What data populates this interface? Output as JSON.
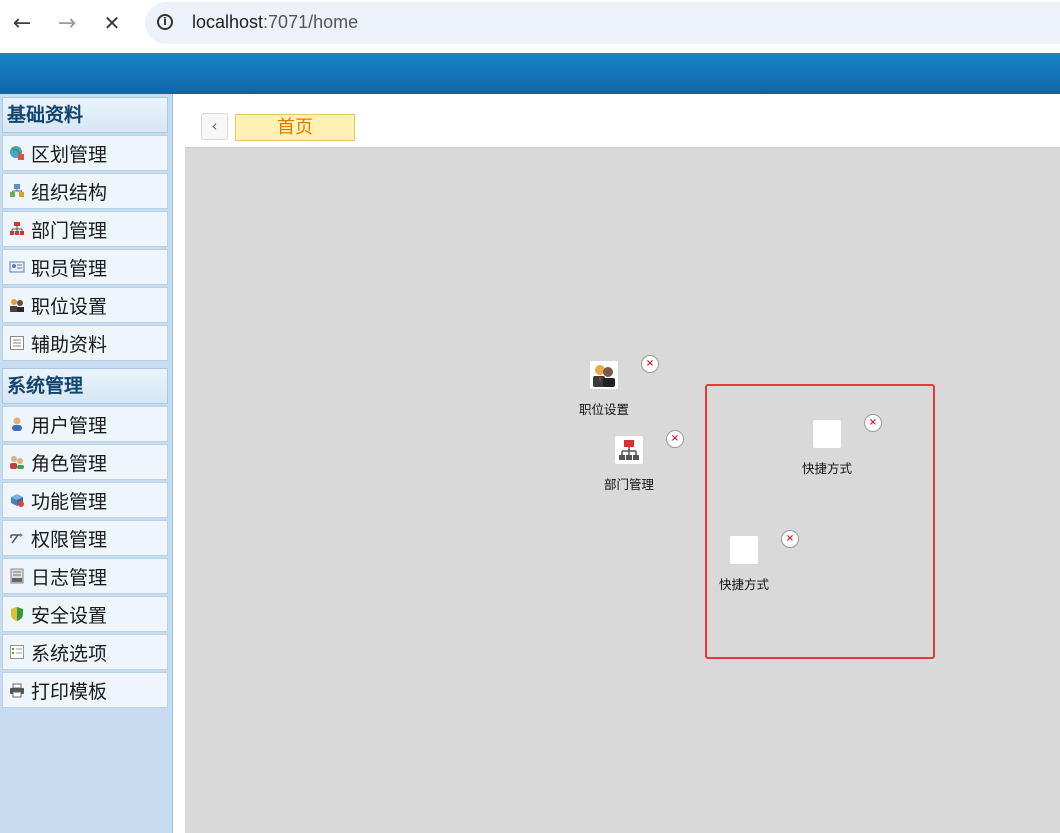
{
  "browser": {
    "back_icon": "←",
    "forward_icon": "→",
    "stop_icon": "✕",
    "info_icon": "i",
    "url_host": "localhost",
    "url_port_path": ":7071/home"
  },
  "sidebar": {
    "groups": [
      {
        "title": "基础资料",
        "items": [
          {
            "label": "区划管理",
            "icon": "region-icon"
          },
          {
            "label": "组织结构",
            "icon": "org-structure-icon"
          },
          {
            "label": "部门管理",
            "icon": "department-icon"
          },
          {
            "label": "职员管理",
            "icon": "staff-card-icon"
          },
          {
            "label": "职位设置",
            "icon": "position-icon"
          },
          {
            "label": "辅助资料",
            "icon": "list-icon"
          }
        ]
      },
      {
        "title": "系统管理",
        "items": [
          {
            "label": "用户管理",
            "icon": "user-icon"
          },
          {
            "label": "角色管理",
            "icon": "role-icon"
          },
          {
            "label": "功能管理",
            "icon": "function-icon"
          },
          {
            "label": "权限管理",
            "icon": "permission-icon"
          },
          {
            "label": "日志管理",
            "icon": "log-icon"
          },
          {
            "label": "安全设置",
            "icon": "shield-icon"
          },
          {
            "label": "系统选项",
            "icon": "options-icon"
          },
          {
            "label": "打印模板",
            "icon": "printer-icon"
          }
        ]
      }
    ]
  },
  "tabs": {
    "scroll_left_icon": "‹",
    "home_label": "首页"
  },
  "desktop": {
    "shortcuts": [
      {
        "label": "职位设置",
        "icon": "position-icon"
      },
      {
        "label": "部门管理",
        "icon": "department-icon"
      },
      {
        "label": "快捷方式",
        "icon": "blank-icon"
      },
      {
        "label": "快捷方式",
        "icon": "blank-icon"
      }
    ],
    "close_icon": "×"
  },
  "colors": {
    "header": "#0e64a4",
    "sidebar_bg": "#c7ddef",
    "tab_active_bg": "#fff0b3",
    "tab_active_text": "#e07b00",
    "desktop_bg": "#d9d9d9",
    "highlight": "#e43a3a"
  }
}
